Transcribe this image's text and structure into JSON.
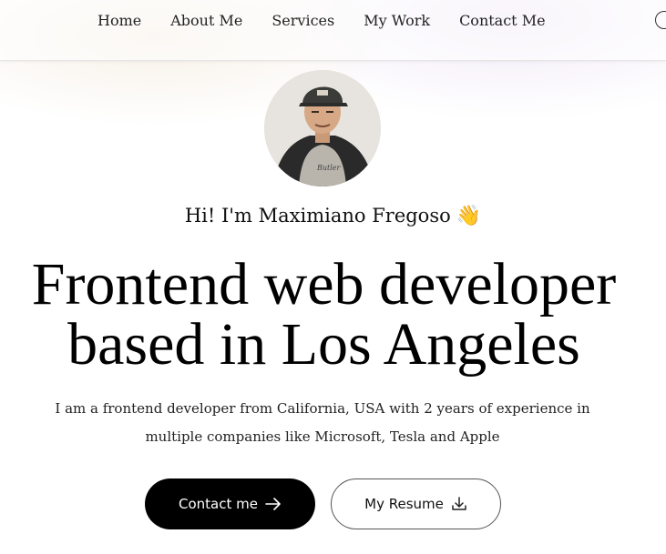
{
  "nav": {
    "items": [
      {
        "label": "Home"
      },
      {
        "label": "About Me"
      },
      {
        "label": "Services"
      },
      {
        "label": "My Work"
      },
      {
        "label": "Contact Me"
      }
    ]
  },
  "hero": {
    "avatar_icon": "profile-photo",
    "avatar_shirt_text": "Butler",
    "greeting": "Hi! I'm Maximiano Fregoso",
    "wave_icon": "👋",
    "headline_line1": "Frontend web developer",
    "headline_line2": "based in Los Angeles",
    "intro": "I am a frontend developer from California, USA with 2 years of experience in multiple companies like Microsoft, Tesla and Apple"
  },
  "buttons": {
    "contact_label": "Contact me",
    "contact_icon": "arrow-right-icon",
    "resume_label": "My Resume",
    "resume_icon": "download-icon"
  },
  "colors": {
    "primary_button_bg": "#000000",
    "primary_button_text": "#ffffff",
    "outline_border": "#555555"
  }
}
